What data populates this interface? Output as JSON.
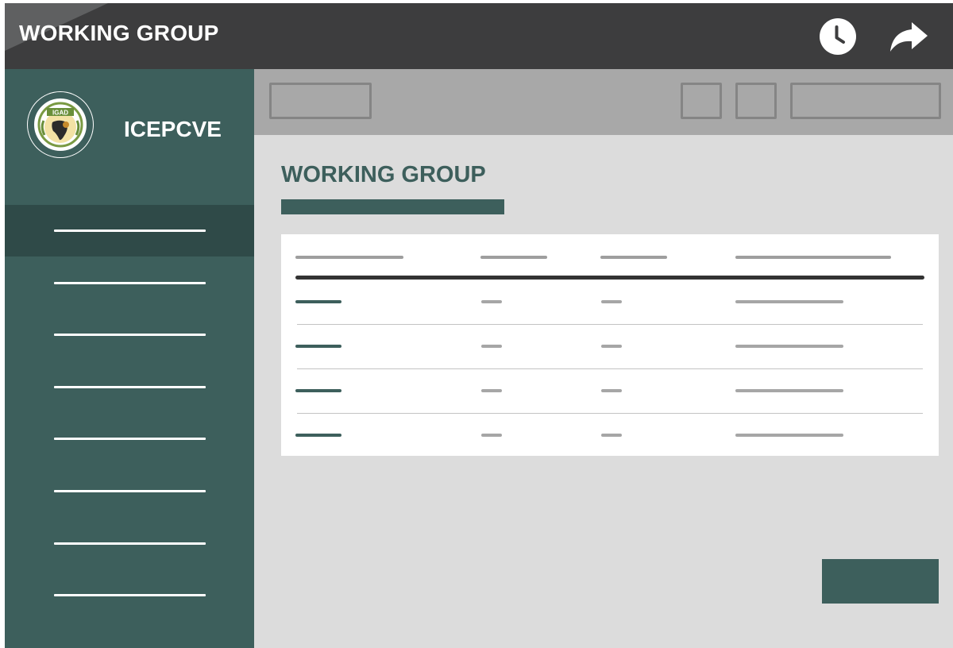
{
  "app": {
    "title": "WORKING GROUP"
  },
  "header_icons": {
    "history": "clock-icon",
    "share": "share-arrow-icon"
  },
  "sidebar": {
    "org_name": "ICEPCVE",
    "logo_icon": "igad-emblem-logo",
    "logo_text": "IGAD",
    "nav_item_count": 8,
    "active_index": 0
  },
  "main": {
    "title": "WORKING GROUP"
  },
  "table": {
    "columns": 4,
    "rows": 4
  },
  "colors": {
    "topbar": "#3d3d3e",
    "sidebar": "#3d5f5c",
    "sidebar_active": "#2f4a48",
    "toolbar": "#a8a8a8",
    "content_bg": "#dcdcdc",
    "accent": "#3d5f5c"
  }
}
